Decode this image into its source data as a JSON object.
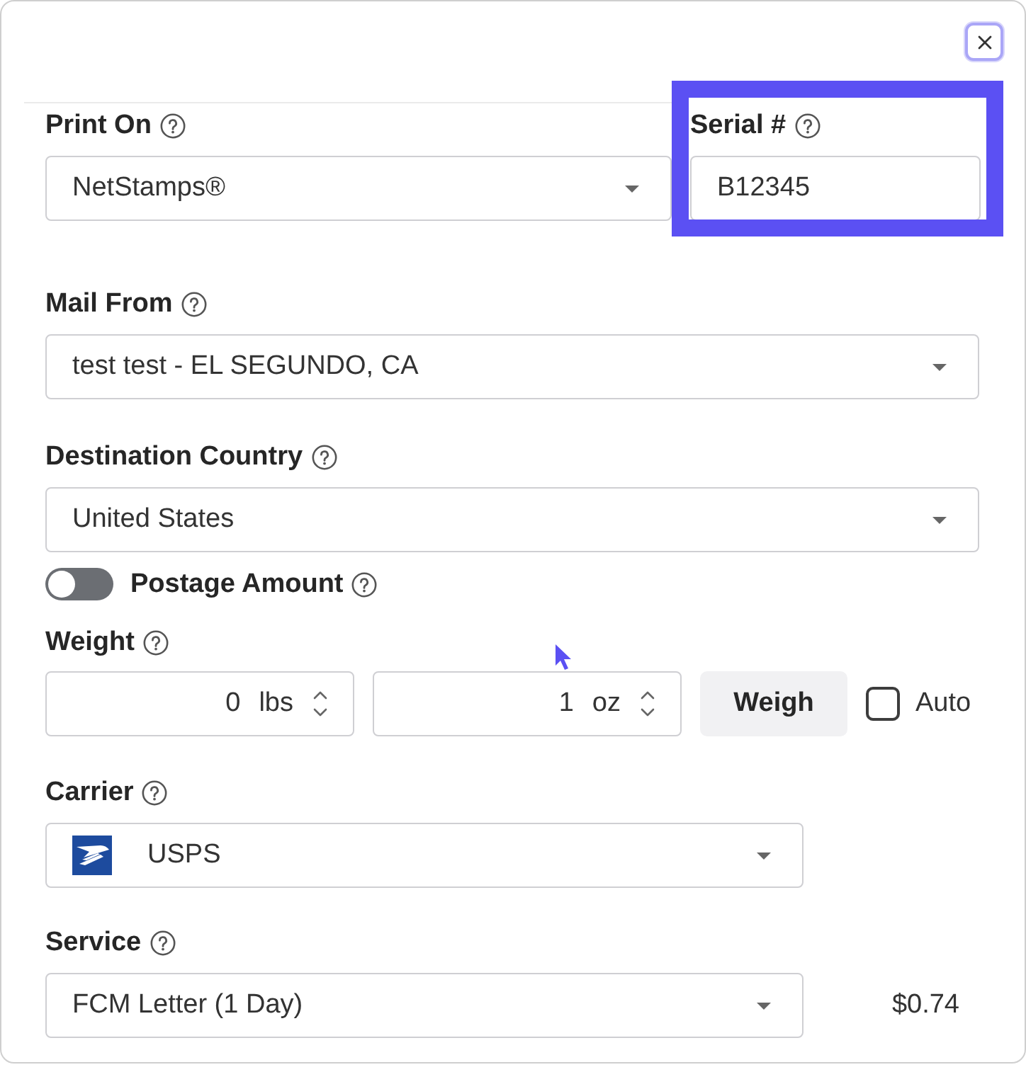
{
  "close_button": {
    "focused": true
  },
  "print_on": {
    "label": "Print On",
    "value": "NetStamps®"
  },
  "serial": {
    "label": "Serial #",
    "value": "B12345",
    "highlighted": true
  },
  "mail_from": {
    "label": "Mail From",
    "value": "test test - EL SEGUNDO, CA"
  },
  "destination_country": {
    "label": "Destination Country",
    "value": "United States"
  },
  "postage_amount": {
    "label": "Postage Amount",
    "on": false
  },
  "weight": {
    "label": "Weight",
    "pounds": {
      "value": "0",
      "unit": "lbs"
    },
    "ounces": {
      "value": "1",
      "unit": "oz"
    },
    "weigh_button": {
      "label": "Weigh"
    },
    "auto": {
      "label": "Auto",
      "checked": false
    }
  },
  "carrier": {
    "label": "Carrier",
    "value": "USPS"
  },
  "service": {
    "label": "Service",
    "value": "FCM Letter (1 Day)",
    "price": "$0.74"
  }
}
